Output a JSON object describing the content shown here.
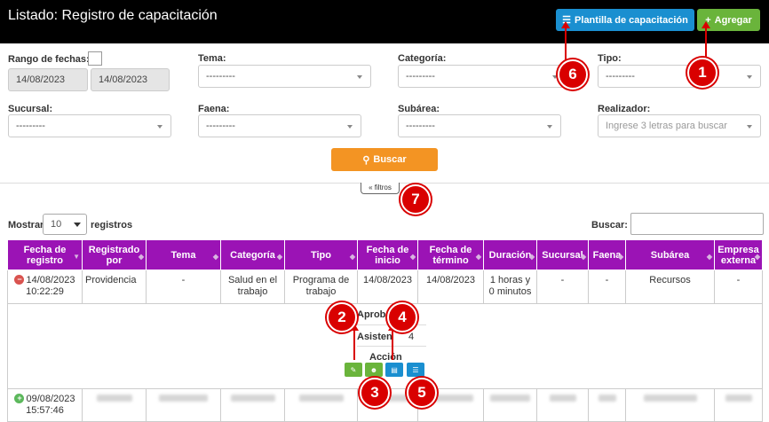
{
  "header": {
    "title": "Listado: Registro de capacitación",
    "plantilla_label": "Plantilla de capacitación",
    "agregar_label": "Agregar"
  },
  "filters": {
    "rango_label": "Rango de fechas:",
    "fecha_desde": "14/08/2023",
    "fecha_hasta": "14/08/2023",
    "tema_label": "Tema:",
    "tema_value": "---------",
    "categoria_label": "Categoría:",
    "categoria_value": "---------",
    "tipo_label": "Tipo:",
    "tipo_value": "---------",
    "sucursal_label": "Sucursal:",
    "sucursal_value": "---------",
    "faena_label": "Faena:",
    "faena_value": "---------",
    "subarea_label": "Subárea:",
    "subarea_value": "---------",
    "realizador_label": "Realizador:",
    "realizador_placeholder": "Ingrese 3 letras para buscar",
    "buscar_button": "Buscar",
    "filtros_toggle": "« filtros"
  },
  "table_controls": {
    "mostrar_label": "Mostrar",
    "length_value": "10",
    "registros_label": "registros",
    "buscar_label": "Buscar:"
  },
  "columns": [
    "Fecha de registro",
    "Registrado por",
    "Tema",
    "Categoría",
    "Tipo",
    "Fecha de inicio",
    "Fecha de término",
    "Duración",
    "Sucursal",
    "Faena",
    "Subárea",
    "Empresa externa"
  ],
  "rows": [
    {
      "fecha_registro": "14/08/2023",
      "hora_registro": "10:22:29",
      "registrado_por": "Providencia",
      "tema": "-",
      "categoria": "Salud en el trabajo",
      "tipo": "Programa de trabajo",
      "fecha_inicio": "14/08/2023",
      "fecha_termino": "14/08/2023",
      "duracion": "1 horas y 0 minutos",
      "sucursal": "-",
      "faena": "-",
      "subarea": "Recursos",
      "empresa": "-"
    },
    {
      "fecha_registro": "09/08/2023",
      "hora_registro": "15:57:46"
    }
  ],
  "detail": {
    "aprobado_label": "Aprob",
    "asistentes_label": "Asisten",
    "asistentes_value": "4",
    "accion_label": "Acción"
  },
  "markers": [
    "1",
    "2",
    "3",
    "4",
    "5",
    "6",
    "7"
  ],
  "colors": {
    "header_bg": "#000000",
    "table_header": "#9b13b5",
    "marker": "#d90000",
    "buscar_button": "#f39423",
    "plantilla_button": "#1a8fd0",
    "agregar_button": "#6ab43b"
  }
}
